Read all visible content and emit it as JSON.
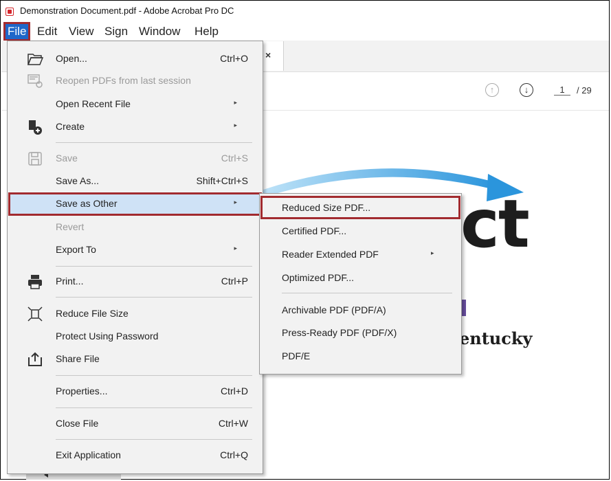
{
  "window": {
    "title": "Demonstration Document.pdf - Adobe Acrobat Pro DC"
  },
  "menubar": {
    "file": "File",
    "edit": "Edit",
    "view": "View",
    "sign": "Sign",
    "window": "Window",
    "help": "Help"
  },
  "tab": {
    "close": "×"
  },
  "nav": {
    "prev": "↑",
    "next": "↓",
    "page": "1",
    "total": "/ 29"
  },
  "document": {
    "big_text": "ct",
    "subtitle": "entucky"
  },
  "file_menu": [
    {
      "label": "Open...",
      "shortcut": "Ctrl+O",
      "icon": "folder-open-icon"
    },
    {
      "label": "Reopen PDFs from last session",
      "shortcut": "",
      "icon": "reopen-icon",
      "disabled": true
    },
    {
      "label": "Open Recent File",
      "shortcut": "",
      "submenu": true
    },
    {
      "label": "Create",
      "shortcut": "",
      "icon": "create-icon",
      "submenu": true
    },
    {
      "label": "Save",
      "shortcut": "Ctrl+S",
      "icon": "save-icon",
      "disabled": true
    },
    {
      "label": "Save As...",
      "shortcut": "Shift+Ctrl+S"
    },
    {
      "label": "Save as Other",
      "shortcut": "",
      "submenu": true,
      "highlighted": true
    },
    {
      "label": "Revert",
      "shortcut": "",
      "disabled": true
    },
    {
      "label": "Export To",
      "shortcut": "",
      "submenu": true
    },
    {
      "label": "Print...",
      "shortcut": "Ctrl+P",
      "icon": "print-icon"
    },
    {
      "label": "Reduce File Size",
      "shortcut": "",
      "icon": "reduce-size-icon"
    },
    {
      "label": "Protect Using Password",
      "shortcut": ""
    },
    {
      "label": "Share File",
      "shortcut": "",
      "icon": "share-icon"
    },
    {
      "label": "Properties...",
      "shortcut": "Ctrl+D"
    },
    {
      "label": "Close File",
      "shortcut": "Ctrl+W"
    },
    {
      "label": "Exit Application",
      "shortcut": "Ctrl+Q"
    }
  ],
  "submenu_arrow": "▸",
  "save_as_other_menu": [
    {
      "label": "Reduced Size PDF...",
      "highlighted": true
    },
    {
      "label": "Certified PDF..."
    },
    {
      "label": "Reader Extended PDF",
      "submenu": true
    },
    {
      "label": "Optimized PDF..."
    },
    {
      "label": "Archivable PDF (PDF/A)"
    },
    {
      "label": "Press-Ready PDF (PDF/X)"
    },
    {
      "label": "PDF/E"
    }
  ],
  "colors": {
    "accent": "#1f67c9",
    "highlight_border": "#a22b2f",
    "menu_bg": "#f2f2f2",
    "hover_bg": "#cfe2f6",
    "arrow": "#3aa0e0"
  }
}
